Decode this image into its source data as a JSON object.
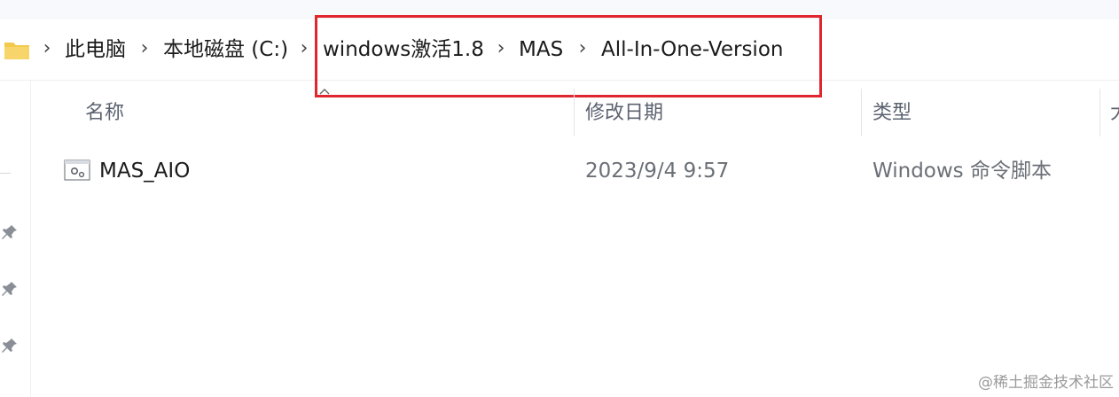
{
  "breadcrumb": {
    "items": [
      {
        "label": "此电脑"
      },
      {
        "label": "本地磁盘 (C:)"
      },
      {
        "label": "windows激活1.8"
      },
      {
        "label": "MAS"
      },
      {
        "label": "All-In-One-Version"
      }
    ],
    "separator": ">",
    "highlight_color": "#e0262e"
  },
  "columns": {
    "name": "名称",
    "modified": "修改日期",
    "type": "类型",
    "size_partial": "大"
  },
  "files": [
    {
      "name": "MAS_AIO",
      "modified": "2023/9/4 9:57",
      "type": "Windows 命令脚本",
      "icon": "batch-file-icon"
    }
  ],
  "watermark": "@稀土掘金技术社区",
  "colors": {
    "text": "#1b1b1b",
    "muted": "#5c6370",
    "highlight": "#e0262e"
  }
}
